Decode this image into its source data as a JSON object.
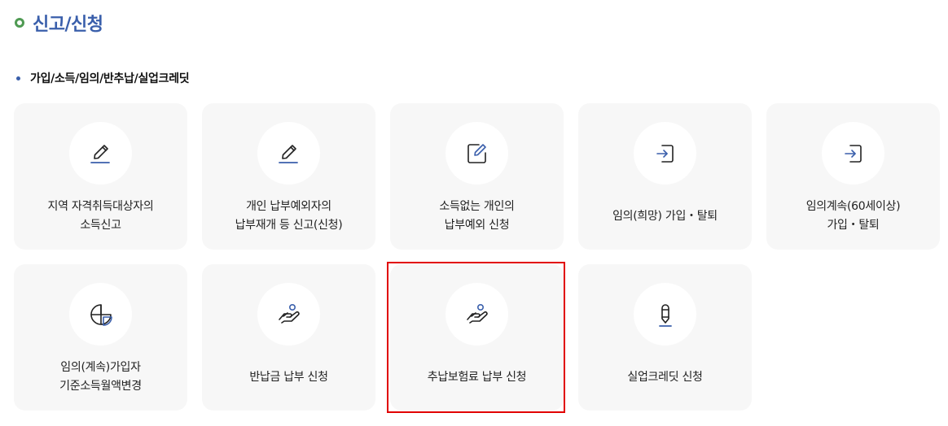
{
  "section": {
    "title": "신고/신청"
  },
  "subsection": {
    "title": "가입/소득/임의/반추납/실업크레딧"
  },
  "cards": [
    {
      "label": "지역 자격취득대상자의\n소득신고",
      "icon": "pencil-underline-icon"
    },
    {
      "label": "개인 납부예외자의\n납부재개 등 신고(신청)",
      "icon": "pencil-underline-icon"
    },
    {
      "label": "소득없는 개인의\n납부예외 신청",
      "icon": "edit-square-icon"
    },
    {
      "label": "임의(희망) 가입・탈퇴",
      "icon": "sign-in-icon"
    },
    {
      "label": "임의계속(60세이상)\n가입・탈퇴",
      "icon": "sign-in-icon"
    },
    {
      "label": "임의(계속)가입자\n기준소득월액변경",
      "icon": "pie-chart-icon"
    },
    {
      "label": "반납금 납부 신청",
      "icon": "hand-payment-icon"
    },
    {
      "label": "추납보험료 납부 신청",
      "icon": "hand-payment-icon"
    },
    {
      "label": "실업크레딧 신청",
      "icon": "pen-icon"
    }
  ],
  "colors": {
    "accent": "#3a5fab",
    "title_dot": "#4f9a53",
    "card_bg": "#f7f7f7",
    "highlight": "#e10000"
  }
}
